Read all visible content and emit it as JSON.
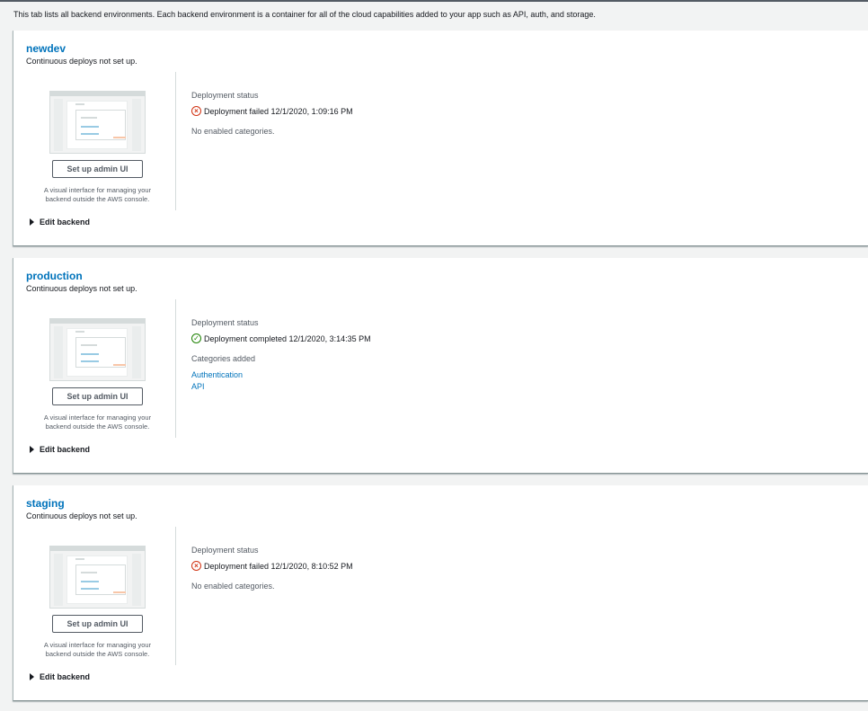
{
  "intro_text": "This tab lists all backend environments. Each backend environment is a container for all of the cloud capabilities added to your app such as API, auth, and storage.",
  "colors": {
    "link": "#0073bb",
    "failed": "#d13212",
    "completed": "#1d8102"
  },
  "backends": [
    {
      "name": "newdev",
      "subtitle": "Continuous deploys not set up.",
      "admin_button": "Set up admin UI",
      "admin_description": "A visual interface for managing your backend outside the AWS console.",
      "edit_label": "Edit backend",
      "status_label": "Deployment status",
      "status_icon": "error-circle-icon",
      "status_text": "Deployment failed 12/1/2020, 1:09:16 PM",
      "categories_text": "No enabled categories.",
      "categories": []
    },
    {
      "name": "production",
      "subtitle": "Continuous deploys not set up.",
      "admin_button": "Set up admin UI",
      "admin_description": "A visual interface for managing your backend outside the AWS console.",
      "edit_label": "Edit backend",
      "status_label": "Deployment status",
      "status_icon": "success-circle-icon",
      "status_text": "Deployment completed 12/1/2020, 3:14:35 PM",
      "categories_text": "Categories added",
      "categories": [
        "Authentication",
        "API"
      ]
    },
    {
      "name": "staging",
      "subtitle": "Continuous deploys not set up.",
      "admin_button": "Set up admin UI",
      "admin_description": "A visual interface for managing your backend outside the AWS console.",
      "edit_label": "Edit backend",
      "status_label": "Deployment status",
      "status_icon": "error-circle-icon",
      "status_text": "Deployment failed 12/1/2020, 8:10:52 PM",
      "categories_text": "No enabled categories.",
      "categories": []
    }
  ]
}
